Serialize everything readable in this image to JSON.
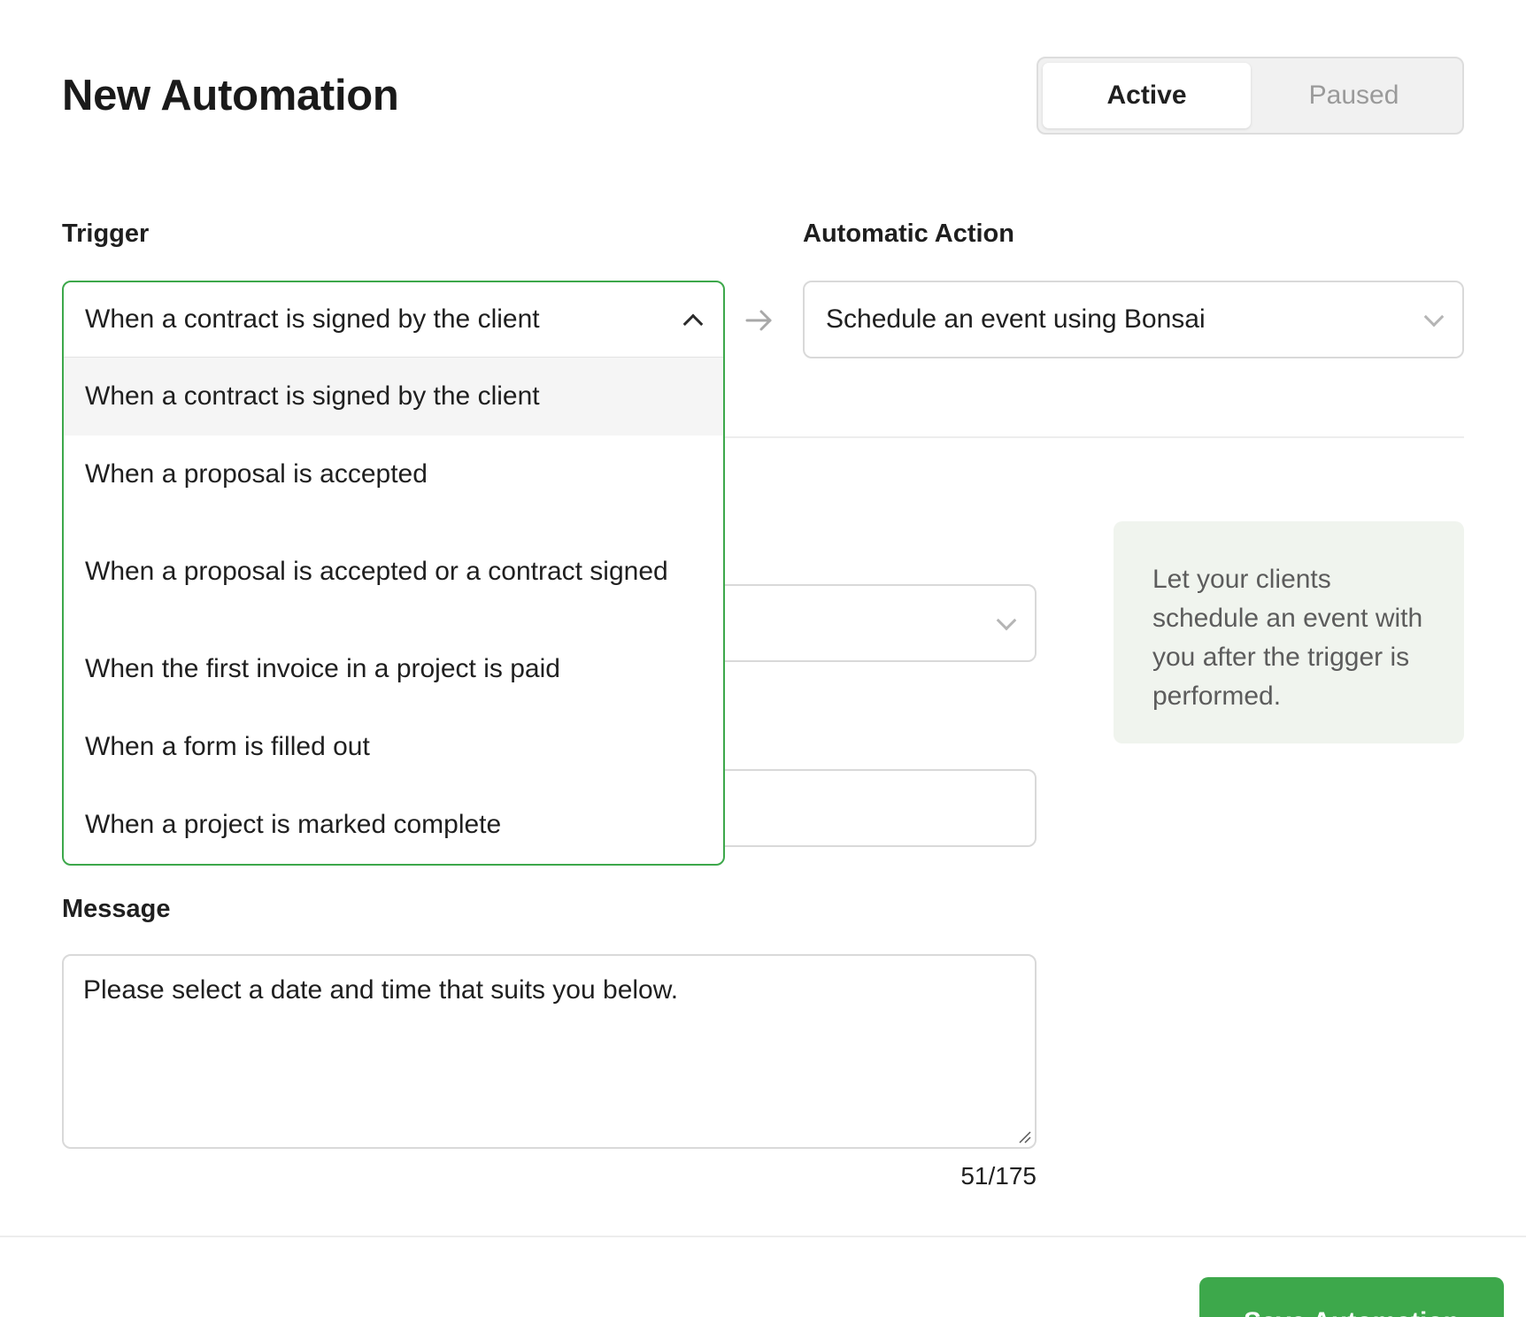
{
  "page": {
    "title": "New Automation"
  },
  "status_toggle": {
    "active_label": "Active",
    "paused_label": "Paused",
    "selected": "Active"
  },
  "trigger": {
    "label": "Trigger",
    "selected": "When a contract is signed by the client",
    "options": [
      "When a contract is signed by the client",
      "When a proposal is accepted",
      "When a proposal is accepted or a contract signed",
      "When the first invoice in a project is paid",
      "When a form is filled out",
      "When a project is marked complete"
    ]
  },
  "action": {
    "label": "Automatic Action",
    "selected": "Schedule an event using Bonsai"
  },
  "info": {
    "text": "Let your clients schedule an event with you after the trigger is performed."
  },
  "message": {
    "label": "Message",
    "value": "Please select a date and time that suits you below.",
    "counter": "51/175"
  },
  "footer": {
    "save_label": "Save Automation"
  },
  "colors": {
    "accent_green": "#3da84b",
    "info_bg": "#f0f4ee"
  }
}
